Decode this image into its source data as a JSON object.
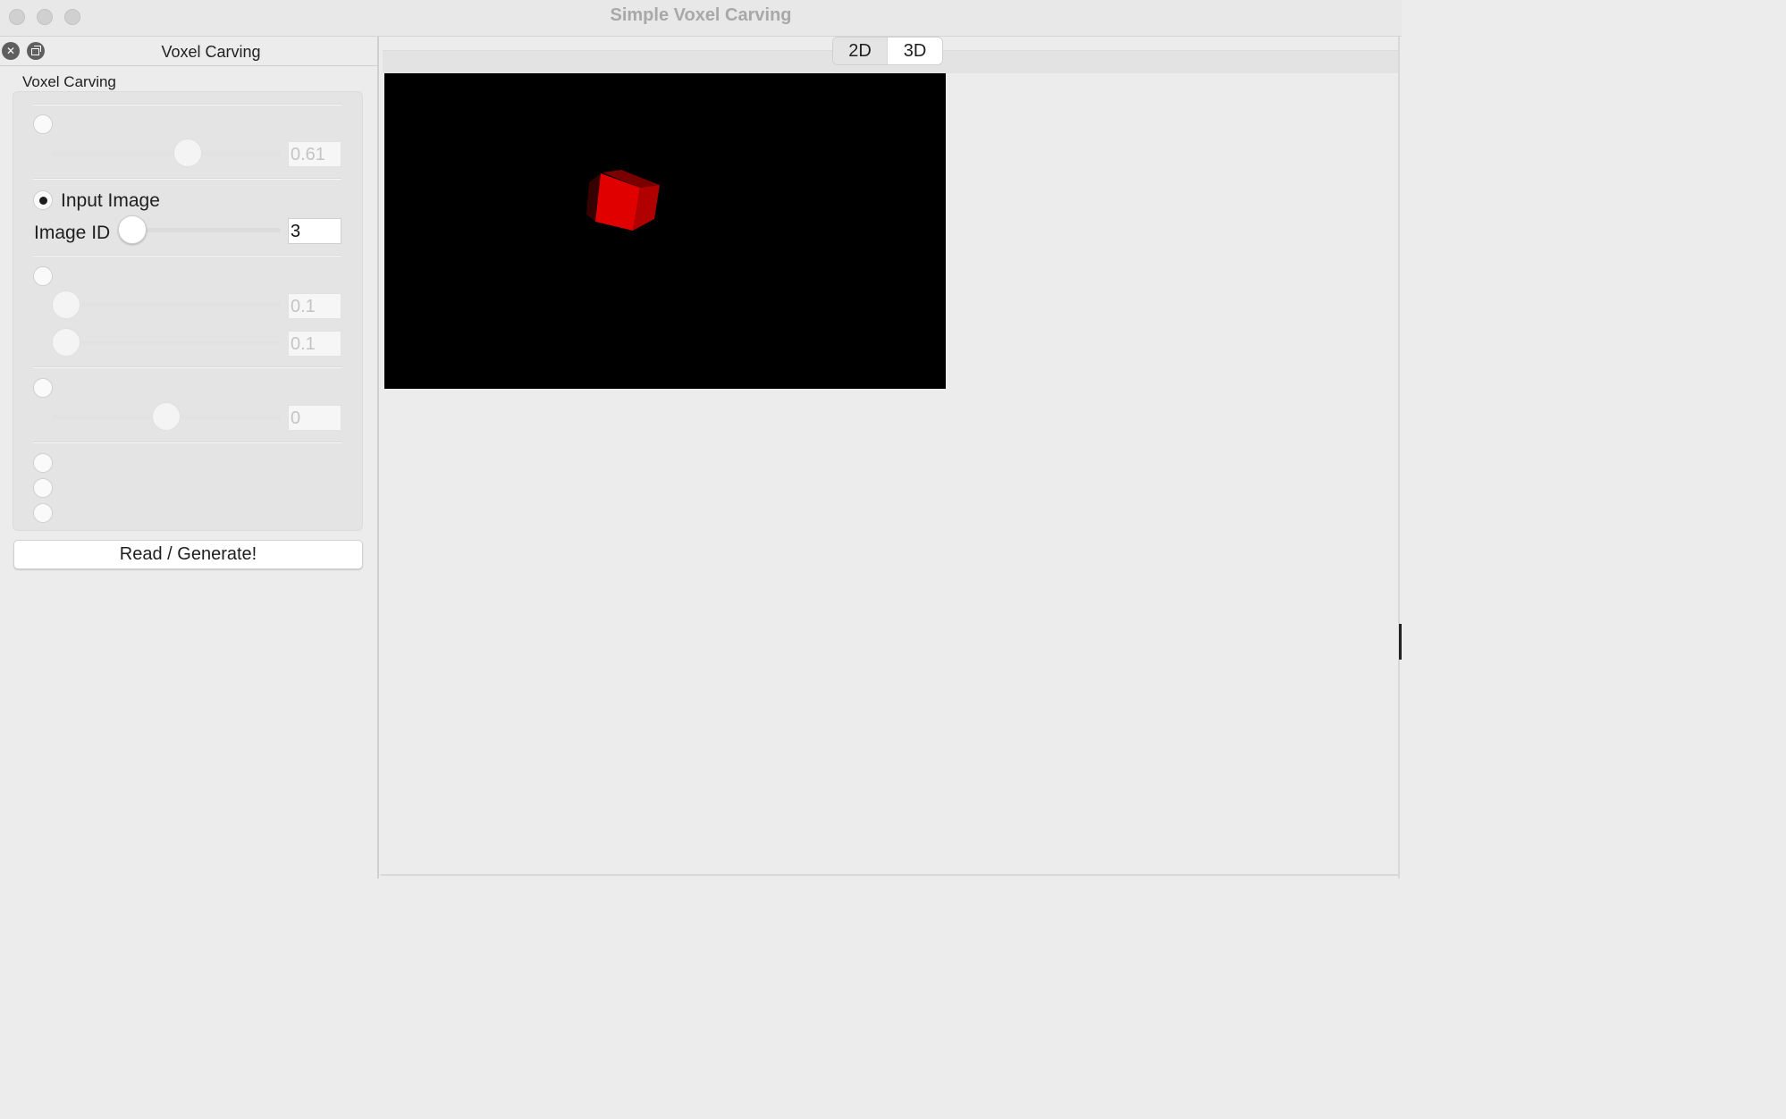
{
  "window": {
    "title": "Simple Voxel Carving"
  },
  "dock": {
    "title": "Voxel Carving",
    "group_label": "Voxel Carving",
    "sections": [
      {
        "radio_checked": false,
        "slider_fraction": 0.59,
        "value": "0.61",
        "enabled": false
      },
      {
        "radio_checked": true,
        "radio_label": "Input Image",
        "field_label": "Image ID",
        "slider_fraction": 0.0,
        "value": "3",
        "enabled": true
      },
      {
        "radio_checked": false,
        "sliders": [
          {
            "slider_fraction": 0.0,
            "value": "0.1"
          },
          {
            "slider_fraction": 0.0,
            "value": "0.1"
          }
        ],
        "enabled": false
      },
      {
        "radio_checked": false,
        "slider_fraction": 0.5,
        "value": "0",
        "enabled": false
      }
    ],
    "extra_radios": [
      {
        "checked": false
      },
      {
        "checked": false
      },
      {
        "checked": false
      }
    ],
    "generate_label": "Read / Generate!"
  },
  "view_tabs": [
    {
      "label": "2D",
      "selected": false
    },
    {
      "label": "3D",
      "selected": true
    }
  ],
  "viewport": {
    "background": "#000000",
    "object_color": "#e00000"
  }
}
